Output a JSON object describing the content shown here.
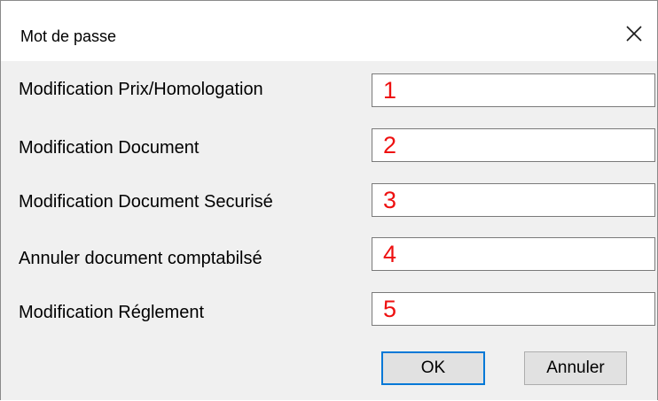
{
  "window": {
    "title": "Mot de passe",
    "close_icon": "close-icon"
  },
  "fields": [
    {
      "label": "Modification Prix/Homologation",
      "value": "1"
    },
    {
      "label": "Modification Document",
      "value": "2"
    },
    {
      "label": "Modification Document Securisé",
      "value": "3"
    },
    {
      "label": "Annuler document comptabilsé",
      "value": "4"
    },
    {
      "label": "Modification Réglement",
      "value": "5"
    }
  ],
  "buttons": {
    "ok_label": "OK",
    "cancel_label": "Annuler"
  },
  "colors": {
    "field_value": "#ee1010",
    "default_button_border": "#0078d7",
    "dialog_background": "#f0f0f0"
  }
}
